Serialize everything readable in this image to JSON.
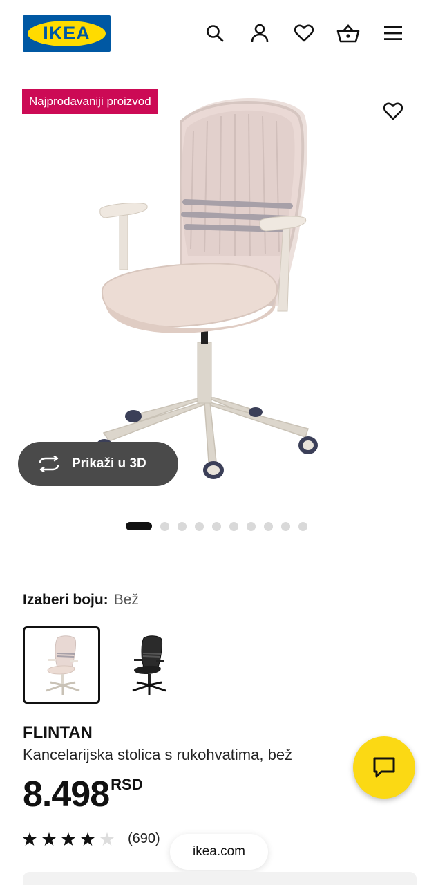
{
  "header": {
    "logo_text": "IKEA",
    "icons": [
      "search-icon",
      "user-icon",
      "heart-icon",
      "basket-icon",
      "menu-icon"
    ]
  },
  "hero": {
    "badge": "Najprodavaniji proizvod",
    "view3d_label": "Prikaži u 3D",
    "image_count": 10,
    "active_index": 0
  },
  "color_select": {
    "label": "Izaberi boju:",
    "value": "Bež",
    "options": [
      "Bež",
      "Crna"
    ]
  },
  "product": {
    "name": "FLINTAN",
    "description": "Kancelarijska stolica s rukohvatima, bež",
    "price": "8.498",
    "currency": "RSD",
    "rating": 4.5,
    "reviews": "(690)"
  },
  "browser": {
    "url": "ikea.com"
  },
  "colors": {
    "brand_blue": "#0058a3",
    "brand_yellow": "#ffdb00",
    "badge_red": "#cc0a55",
    "chat_yellow": "#fbd914"
  }
}
